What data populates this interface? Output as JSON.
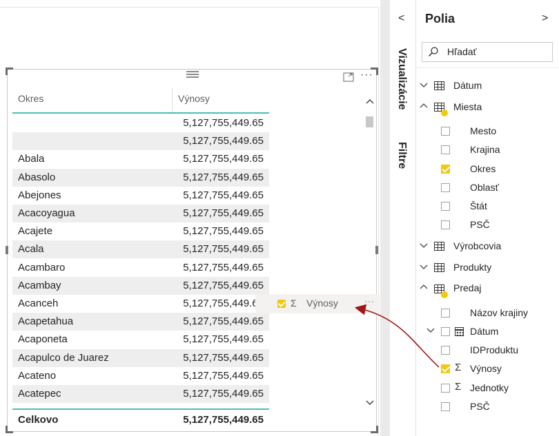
{
  "table": {
    "col_okres": "Okres",
    "col_vynosy": "Výnosy",
    "rows": [
      {
        "okres": "",
        "vynosy": "5,127,755,449.65"
      },
      {
        "okres": "",
        "vynosy": "5,127,755,449.65"
      },
      {
        "okres": "Abala",
        "vynosy": "5,127,755,449.65"
      },
      {
        "okres": "Abasolo",
        "vynosy": "5,127,755,449.65"
      },
      {
        "okres": "Abejones",
        "vynosy": "5,127,755,449.65"
      },
      {
        "okres": "Acacoyagua",
        "vynosy": "5,127,755,449.65"
      },
      {
        "okres": "Acajete",
        "vynosy": "5,127,755,449.65"
      },
      {
        "okres": "Acala",
        "vynosy": "5,127,755,449.65"
      },
      {
        "okres": "Acambaro",
        "vynosy": "5,127,755,449.65"
      },
      {
        "okres": "Acambay",
        "vynosy": "5,127,755,449.65"
      },
      {
        "okres": "Acanceh",
        "vynosy": "5,127,755,449.65"
      },
      {
        "okres": "Acapetahua",
        "vynosy": "5,127,755,449.65"
      },
      {
        "okres": "Acaponeta",
        "vynosy": "5,127,755,449.65"
      },
      {
        "okres": "Acapulco de Juarez",
        "vynosy": "5,127,755,449.65"
      },
      {
        "okres": "Acateno",
        "vynosy": "5,127,755,449.65"
      },
      {
        "okres": "Acatepec",
        "vynosy": "5,127,755,449.65"
      }
    ],
    "total_label": "Celkovo",
    "total_value": "5,127,755,449.65"
  },
  "drag_ghost": {
    "label": "Výnosy",
    "sigma": "Σ",
    "more": "···"
  },
  "visual_header": {
    "more": "···"
  },
  "viz_pane": {
    "vizualizacie": "Vizualizácie",
    "filtre": "Filtre",
    "chevron": "<"
  },
  "fields_pane": {
    "title": "Polia",
    "chevron": ">",
    "search_placeholder": "Hľadať",
    "tables": {
      "datum": "Dátum",
      "miesta": "Miesta",
      "vyrobcovia": "Výrobcovia",
      "produkty": "Produkty",
      "predaj": "Predaj"
    },
    "miesta_fields": [
      "Mesto",
      "Krajina",
      "Okres",
      "Oblasť",
      "Štát",
      "PSČ"
    ],
    "predaj_fields": [
      "Názov krajiny",
      "Dátum",
      "IDProduktu",
      "Výnosy",
      "Jednotky",
      "PSČ"
    ]
  },
  "colors": {
    "accent_teal": "#4fbcb8",
    "checkbox_yellow": "#f2c811",
    "arrow_red": "#a31515"
  }
}
